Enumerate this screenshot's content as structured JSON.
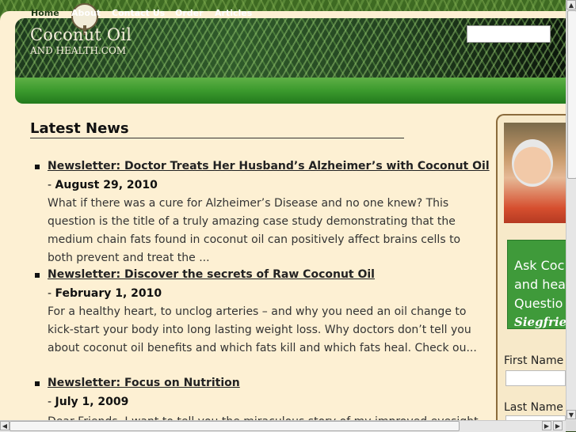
{
  "header": {
    "logo_title": "Coconut Oil",
    "logo_subtitle": "AND HEALTH.COM"
  },
  "nav": {
    "items": [
      {
        "label": "Home",
        "active": true
      },
      {
        "label": "About",
        "active": false
      },
      {
        "label": "Contact Us",
        "active": false
      },
      {
        "label": "Order",
        "active": false
      },
      {
        "label": "Articles",
        "active": false
      }
    ]
  },
  "main": {
    "section_title": "Latest News",
    "news": [
      {
        "title": "Newsletter: Doctor Treats Her Husband’s Alzheimer’s with Coconut Oil",
        "date_prefix": "- ",
        "date": "August 29, 2010",
        "excerpt": "What if there was a cure for Alzheimer’s Disease and no one knew? This question is the title of a truly amazing case study demonstrating that the medium chain fats found in coconut oil can positively affect brains cells to both prevent and treat the ..."
      },
      {
        "title": "Newsletter: Discover the secrets of Raw Coconut Oil",
        "date_prefix": "- ",
        "date": "February 1, 2010",
        "excerpt": "For a healthy heart, to unclog arteries – and why you need an oil change to kick-start your body into long lasting weight loss. Why doctors don’t tell you about coconut oil benefits and which fats kill and which fats heal. Check ou..."
      },
      {
        "title": "Newsletter: Focus on Nutrition",
        "date_prefix": "- ",
        "date": "July 1, 2009",
        "excerpt": "Dear Friends, I want to tell you the miraculous story of my improved eyesight. Since"
      }
    ]
  },
  "sidebar": {
    "ask_lines": [
      "Ask Coc",
      "and hea",
      "Questio"
    ],
    "ask_signature": "Siegfrie",
    "first_name_label": "First Name (",
    "last_name_label": "Last Name (",
    "first_name_value": "",
    "last_name_value": ""
  },
  "colors": {
    "page_bg": "#fdf0d3",
    "nav_green": "#3b9a2d",
    "ask_green": "#3f9a3a"
  }
}
